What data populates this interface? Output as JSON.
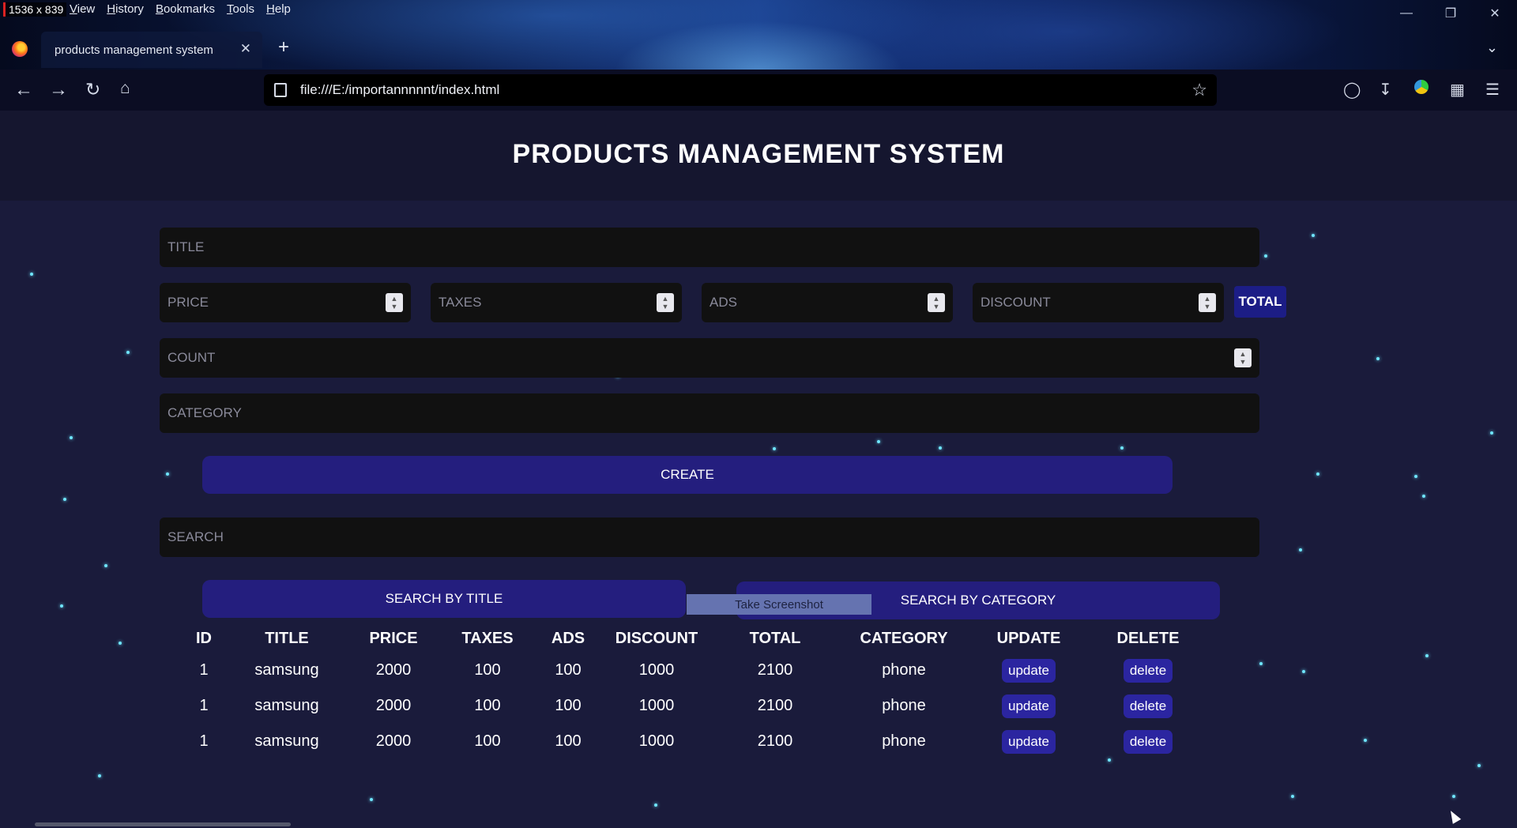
{
  "browser": {
    "resolution_badge": "1536 x 839",
    "menu": [
      "View",
      "History",
      "Bookmarks",
      "Tools",
      "Help"
    ],
    "tab_title": "products management system",
    "url": "file:///E:/importannnnnt/index.html"
  },
  "page": {
    "title": "PRODUCTS MANAGEMENT SYSTEM",
    "form": {
      "title_placeholder": "TITLE",
      "price_placeholder": "PRICE",
      "taxes_placeholder": "TAXES",
      "ads_placeholder": "ADS",
      "discount_placeholder": "DISCOUNT",
      "total_label": "TOTAL",
      "count_placeholder": "COUNT",
      "category_placeholder": "CATEGORY",
      "create_label": "CREATE"
    },
    "search": {
      "placeholder": "SEARCH",
      "by_title_label": "SEARCH BY TITLE",
      "by_category_label": "SEARCH BY CATEGORY",
      "screenshot_tip": "Take Screenshot"
    },
    "table": {
      "headers": [
        "ID",
        "TITLE",
        "PRICE",
        "TAXES",
        "ADS",
        "DISCOUNT",
        "TOTAL",
        "CATEGORY",
        "UPDATE",
        "DELETE"
      ],
      "rows": [
        {
          "id": "1",
          "title": "samsung",
          "price": "2000",
          "taxes": "100",
          "ads": "100",
          "discount": "1000",
          "total": "2100",
          "category": "phone",
          "update": "update",
          "delete": "delete"
        },
        {
          "id": "1",
          "title": "samsung",
          "price": "2000",
          "taxes": "100",
          "ads": "100",
          "discount": "1000",
          "total": "2100",
          "category": "phone",
          "update": "update",
          "delete": "delete"
        },
        {
          "id": "1",
          "title": "samsung",
          "price": "2000",
          "taxes": "100",
          "ads": "100",
          "discount": "1000",
          "total": "2100",
          "category": "phone",
          "update": "update",
          "delete": "delete"
        }
      ]
    }
  },
  "colors": {
    "page_bg": "#1a1b3b",
    "header_bg": "#15162f",
    "button_bg": "#241e7e",
    "input_bg": "#111111",
    "star": "#6fe6ff"
  }
}
